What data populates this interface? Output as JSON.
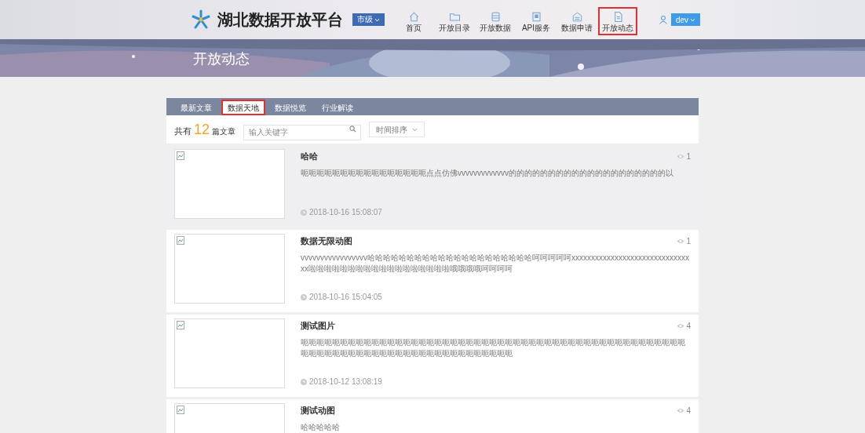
{
  "header": {
    "title": "湖北数据开放平台",
    "region": "市级",
    "nav": [
      {
        "label": "首页",
        "selected": false
      },
      {
        "label": "开放目录",
        "selected": false
      },
      {
        "label": "开放数据",
        "selected": false
      },
      {
        "label": "API服务",
        "selected": false
      },
      {
        "label": "数据申请",
        "selected": false
      },
      {
        "label": "开放动态",
        "selected": true
      }
    ],
    "user": "dev"
  },
  "banner": {
    "title": "开放动态"
  },
  "tabs": [
    {
      "label": "最新文章",
      "selected": false
    },
    {
      "label": "数据天地",
      "selected": true
    },
    {
      "label": "数据悦览",
      "selected": false
    },
    {
      "label": "行业解读",
      "selected": false
    }
  ],
  "summary": {
    "prefix": "共有",
    "count": "12",
    "suffix": "篇文章"
  },
  "search": {
    "placeholder": "输入关键字"
  },
  "sort": {
    "value": "时间排序"
  },
  "articles": [
    {
      "title": "哈哈",
      "body": "呃呃呃呃呃呃呃呃呃呃呃呃呃呃呃呃点点仿佛vvvvvvvvvvvvv的的的的的的的的的的的的的的的的的的的的以",
      "date": "2018-10-16 15:08:07",
      "views": "1",
      "hovered": true
    },
    {
      "title": "数据无限动图",
      "body": "vvvvvvvvvvvvvvvvv哈哈哈哈哈哈哈哈哈哈哈哈哈哈哈哈哈哈哈哈哈呵呵呵呵呵xxxxxxxxxxxxxxxxxxxxxxxxxxxxxxxx啦啦啦啦啦啦啦啦啦啦啦啦啦啦啦啦啦啦哦哦哦哦呵呵呵呵",
      "date": "2018-10-16 15:04:05",
      "views": "1",
      "hovered": false
    },
    {
      "title": "测试图片",
      "body": "呃呃呃呃呃呃呃呃呃呃呃呃呃呃呃呃呃呃呃呃呃呃呃呃呃呃呃呃呃呃呃呃呃呃呃呃呃呃呃呃呃呃呃呃呃呃呃呃呃呃呃呃呃呃呃呃呃呃呃呃呃呃呃呃呃呃呃呃呃呃呃呃呃呃呃呃",
      "date": "2018-10-12 13:08:19",
      "views": "4",
      "hovered": false
    },
    {
      "title": "测试动图",
      "body": "哈哈哈哈哈",
      "views": "4",
      "hovered": false
    }
  ]
}
